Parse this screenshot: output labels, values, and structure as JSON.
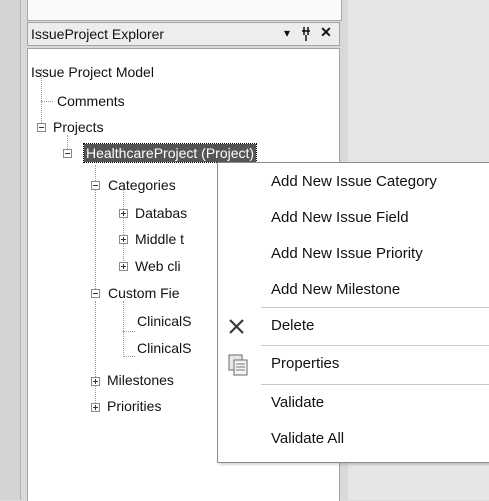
{
  "explorer": {
    "title": "IssueProject Explorer",
    "dropdown_glyph": "▾",
    "pin_glyph": "ᵼ",
    "close_glyph": "✕"
  },
  "tree": {
    "root": "Issue Project Model",
    "comments": "Comments",
    "projects": "Projects",
    "healthcare": "HealthcareProject (Project)",
    "categories": "Categories",
    "cat_database": "Databas",
    "cat_middle": "Middle t",
    "cat_web": "Web cli",
    "custom_fields": "Custom Fie",
    "cf_clinical1": "ClinicalS",
    "cf_clinical2": "ClinicalS",
    "milestones": "Milestones",
    "priorities": "Priorities"
  },
  "context_menu": {
    "items": [
      {
        "label": "Add New Issue Category",
        "icon": ""
      },
      {
        "label": "Add New Issue Field",
        "icon": ""
      },
      {
        "label": "Add New Issue Priority",
        "icon": ""
      },
      {
        "label": "Add New Milestone",
        "icon": ""
      },
      {
        "label": "Delete",
        "icon": "delete-x-icon"
      },
      {
        "label": "Properties",
        "icon": "properties-icon"
      },
      {
        "label": "Validate",
        "icon": ""
      },
      {
        "label": "Validate All",
        "icon": ""
      }
    ]
  }
}
